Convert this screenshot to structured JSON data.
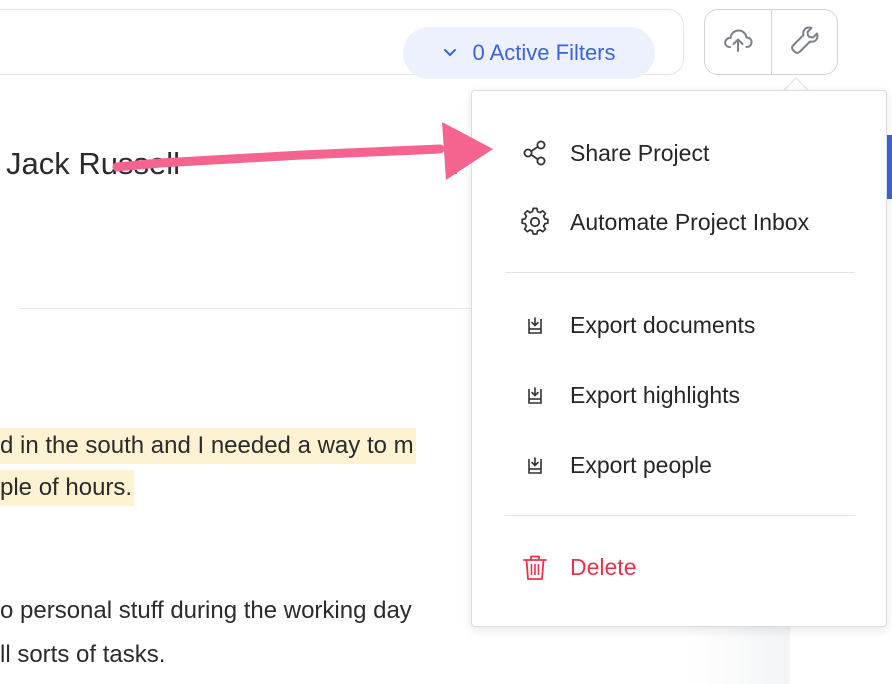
{
  "toolbar": {
    "filters_label": "0 Active Filters",
    "upload_icon": "cloud-upload-icon",
    "settings_icon": "wrench-icon"
  },
  "document": {
    "title": "Jack Russell",
    "marker": ":",
    "highlight_lines": [
      "d in the south and I needed a way to m",
      "ple of hours."
    ],
    "body_lines": [
      "o personal stuff during the working day",
      "ll sorts of tasks."
    ]
  },
  "menu": {
    "items": [
      {
        "label": "Share Project",
        "icon": "share-icon"
      },
      {
        "label": "Automate Project Inbox",
        "icon": "gear-icon"
      },
      {
        "label": "Export documents",
        "icon": "export-icon"
      },
      {
        "label": "Export highlights",
        "icon": "export-icon"
      },
      {
        "label": "Export people",
        "icon": "export-icon"
      },
      {
        "label": "Delete",
        "icon": "trash-icon"
      }
    ]
  },
  "colors": {
    "accent": "#3d63d8",
    "filter_bg": "#edf1fd",
    "highlight": "#fdf2d2",
    "danger": "#e8334a",
    "annotation_arrow": "#f4648f"
  }
}
